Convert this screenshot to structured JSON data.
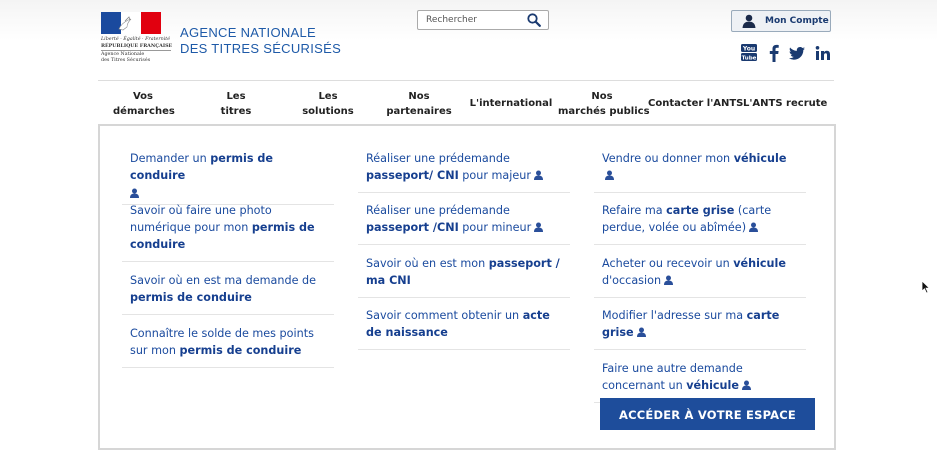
{
  "logo": {
    "motto": "Liberté · Égalité · Fraternité",
    "republic": "RÉPUBLIQUE FRANÇAISE",
    "agency_line1": "Agence Nationale",
    "agency_line2": "des Titres Sécurisés"
  },
  "header": {
    "agency_line1": "AGENCE NATIONALE",
    "agency_line2": "DES TITRES SÉCURISÉS",
    "search_placeholder": "Rechercher",
    "account_label": "Mon Compte",
    "social": [
      "youtube-icon",
      "facebook-icon",
      "twitter-icon",
      "linkedin-icon"
    ]
  },
  "nav": {
    "items": [
      {
        "line1": "Vos",
        "line2": "démarches"
      },
      {
        "line1": "Les",
        "line2": "titres"
      },
      {
        "line1": "Les",
        "line2": "solutions"
      },
      {
        "line1": "Nos",
        "line2": "partenaires"
      },
      {
        "line1": "L'international",
        "line2": ""
      },
      {
        "line1": "Nos",
        "line2": "marchés publics"
      },
      {
        "line1": "Contacter l'ANTS",
        "line2": ""
      },
      {
        "line1": "L'ANTS recrute",
        "line2": ""
      }
    ]
  },
  "panel": {
    "col1": [
      {
        "pre": "Demander un ",
        "bold": "permis de conduire",
        "post": ""
      },
      {
        "pre": "Savoir où faire une photo numérique pour mon ",
        "bold": "permis de conduire",
        "post": ""
      },
      {
        "pre": "Savoir où en est ma demande de ",
        "bold": "permis de conduire",
        "post": ""
      },
      {
        "pre": "Connaître le solde de mes points sur mon ",
        "bold": "permis de conduire",
        "post": ""
      }
    ],
    "col2": [
      {
        "pre": "Réaliser une prédemande ",
        "bold": "passeport/ CNI",
        "post": " pour majeur"
      },
      {
        "pre": "Réaliser une prédemande ",
        "bold": "passeport /CNI",
        "post": " pour mineur"
      },
      {
        "pre": "Savoir où en est mon ",
        "bold": "passeport / ma CNI",
        "post": ""
      },
      {
        "pre": "Savoir comment obtenir un ",
        "bold": "acte de naissance",
        "post": ""
      }
    ],
    "col3": [
      {
        "pre": "Vendre ou donner mon ",
        "bold": "véhicule",
        "post": ""
      },
      {
        "pre": "Refaire ma ",
        "bold": "carte grise",
        "post": " (carte perdue, volée ou abîmée)"
      },
      {
        "pre": "Acheter ou recevoir un ",
        "bold": "véhicule",
        "post": " d'occasion"
      },
      {
        "pre": "Modifier l'adresse sur ma ",
        "bold": "carte grise",
        "post": ""
      },
      {
        "pre": "Faire une autre demande concernant un ",
        "bold": "véhicule",
        "post": ""
      }
    ],
    "cta_label": "ACCÉDER À VOTRE ESPACE"
  },
  "colors": {
    "brand_blue": "#1e4d9b",
    "link_blue": "#1a4a9e",
    "flag_red": "#e1000f"
  }
}
